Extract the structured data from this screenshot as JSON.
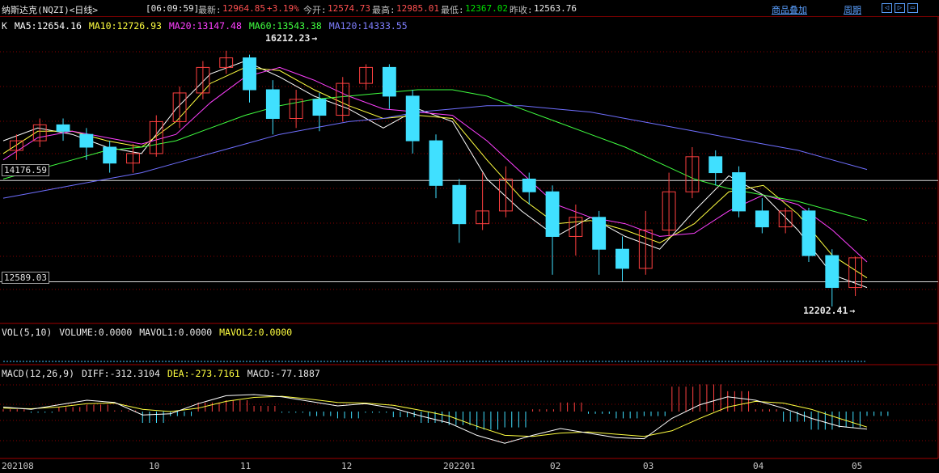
{
  "header": {
    "title": "纳斯达克(NQZI)<日线>",
    "time": "[06:09:59]",
    "latest_label": "最新:",
    "latest_value": "12964.85",
    "change_pct": "+3.19%",
    "open_label": "今开:",
    "open_value": "12574.73",
    "high_label": "最高:",
    "high_value": "12985.01",
    "low_label": "最低:",
    "low_value": "12367.02",
    "prev_label": "昨收:",
    "prev_value": "12563.76",
    "overlay_link": "商品叠加",
    "period_link": "周期",
    "controls": [
      "◁",
      "▷",
      "▭"
    ]
  },
  "k_legend": {
    "prefix": "K",
    "ma5": "MA5:12654.16",
    "ma10": "MA10:12726.93",
    "ma20": "MA20:13147.48",
    "ma60": "MA60:13543.38",
    "ma120": "MA120:14333.55"
  },
  "vol_legend": {
    "name": "VOL(5,10)",
    "volume": "VOLUME:0.0000",
    "mavol1": "MAVOL1:0.0000",
    "mavol2": "MAVOL2:0.0000"
  },
  "macd_legend": {
    "name": "MACD(12,26,9)",
    "diff": "DIFF:-312.3104",
    "dea": "DEA:-273.7161",
    "macd": "MACD:-77.1887"
  },
  "price_levels": {
    "upper": "14176.59",
    "lower": "12589.03"
  },
  "annotations": {
    "high": "16212.23",
    "low": "12202.41"
  },
  "colors": {
    "up": "#ff4040",
    "down": "#40e0ff",
    "ma5": "#ffffff",
    "ma10": "#ffff40",
    "ma20": "#ff40ff",
    "ma60": "#40ff40",
    "ma120": "#6f6fff",
    "grid": "#8a0000"
  },
  "chart_data": {
    "type": "candlestick",
    "x_tick_labels": [
      "202108",
      "10",
      "11",
      "12",
      "202201",
      "02",
      "03",
      "04",
      "05"
    ],
    "price_ylim": [
      12000,
      16500
    ],
    "ma_series": [
      {
        "name": "MA5",
        "values": [
          14800,
          15000,
          14900,
          14700,
          14600,
          15300,
          15850,
          16050,
          15800,
          15500,
          15300,
          15000,
          15300,
          15100,
          14200,
          13700,
          13300,
          13600,
          13300,
          13100,
          13700,
          14250,
          13950,
          13400,
          12700,
          12500
        ]
      },
      {
        "name": "MA10",
        "values": [
          14600,
          14950,
          14950,
          14800,
          14700,
          15100,
          15700,
          15950,
          15900,
          15600,
          15350,
          15150,
          15200,
          15150,
          14500,
          13900,
          13500,
          13550,
          13400,
          13200,
          13500,
          14000,
          14100,
          13650,
          13000,
          12650
        ]
      },
      {
        "name": "MA20",
        "values": [
          14500,
          14850,
          14950,
          14850,
          14750,
          14900,
          15400,
          15800,
          15950,
          15750,
          15500,
          15300,
          15250,
          15200,
          14800,
          14300,
          13800,
          13600,
          13500,
          13300,
          13350,
          13700,
          13950,
          13800,
          13400,
          12900
        ]
      },
      {
        "name": "MA60",
        "values": [
          14200,
          14350,
          14500,
          14650,
          14700,
          14800,
          15000,
          15200,
          15350,
          15450,
          15500,
          15550,
          15600,
          15600,
          15500,
          15300,
          15100,
          14900,
          14700,
          14450,
          14200,
          14050,
          13950,
          13850,
          13700,
          13550
        ]
      },
      {
        "name": "MA120",
        "values": [
          13900,
          14000,
          14100,
          14200,
          14300,
          14450,
          14600,
          14750,
          14900,
          15000,
          15100,
          15150,
          15250,
          15300,
          15350,
          15350,
          15300,
          15250,
          15150,
          15050,
          14950,
          14850,
          14750,
          14650,
          14500,
          14350
        ]
      }
    ],
    "candles": [
      {
        "o": 14650,
        "c": 14800,
        "h": 14900,
        "l": 14500
      },
      {
        "o": 14800,
        "c": 15050,
        "h": 15150,
        "l": 14700
      },
      {
        "o": 15050,
        "c": 14950,
        "h": 15150,
        "l": 14800
      },
      {
        "o": 14900,
        "c": 14700,
        "h": 15000,
        "l": 14500
      },
      {
        "o": 14700,
        "c": 14450,
        "h": 14800,
        "l": 14300
      },
      {
        "o": 14450,
        "c": 14600,
        "h": 14750,
        "l": 14300
      },
      {
        "o": 14600,
        "c": 15100,
        "h": 15200,
        "l": 14550
      },
      {
        "o": 15100,
        "c": 15550,
        "h": 15650,
        "l": 15000
      },
      {
        "o": 15550,
        "c": 15950,
        "h": 16050,
        "l": 15450
      },
      {
        "o": 15950,
        "c": 16100,
        "h": 16212,
        "l": 15850
      },
      {
        "o": 16100,
        "c": 15600,
        "h": 16150,
        "l": 15400
      },
      {
        "o": 15600,
        "c": 15150,
        "h": 15750,
        "l": 14900
      },
      {
        "o": 15150,
        "c": 15450,
        "h": 15600,
        "l": 15000
      },
      {
        "o": 15450,
        "c": 15200,
        "h": 15550,
        "l": 14950
      },
      {
        "o": 15200,
        "c": 15700,
        "h": 15800,
        "l": 15100
      },
      {
        "o": 15700,
        "c": 15950,
        "h": 16000,
        "l": 15600
      },
      {
        "o": 15950,
        "c": 15500,
        "h": 16000,
        "l": 15300
      },
      {
        "o": 15500,
        "c": 14800,
        "h": 15600,
        "l": 14600
      },
      {
        "o": 14800,
        "c": 14100,
        "h": 14900,
        "l": 13900
      },
      {
        "o": 14100,
        "c": 13500,
        "h": 14200,
        "l": 13200
      },
      {
        "o": 13500,
        "c": 13700,
        "h": 14300,
        "l": 13400
      },
      {
        "o": 13700,
        "c": 14200,
        "h": 14400,
        "l": 13600
      },
      {
        "o": 14200,
        "c": 14000,
        "h": 14300,
        "l": 13800
      },
      {
        "o": 14000,
        "c": 13300,
        "h": 14100,
        "l": 12700
      },
      {
        "o": 13300,
        "c": 13600,
        "h": 13800,
        "l": 13000
      },
      {
        "o": 13600,
        "c": 13100,
        "h": 13700,
        "l": 12700
      },
      {
        "o": 13100,
        "c": 12800,
        "h": 13300,
        "l": 12600
      },
      {
        "o": 12800,
        "c": 13400,
        "h": 13700,
        "l": 12700
      },
      {
        "o": 13400,
        "c": 14000,
        "h": 14300,
        "l": 13300
      },
      {
        "o": 14000,
        "c": 14550,
        "h": 14700,
        "l": 13900
      },
      {
        "o": 14550,
        "c": 14300,
        "h": 14650,
        "l": 14100
      },
      {
        "o": 14300,
        "c": 13700,
        "h": 14400,
        "l": 13600
      },
      {
        "o": 13700,
        "c": 13450,
        "h": 13900,
        "l": 13350
      },
      {
        "o": 13450,
        "c": 13700,
        "h": 13750,
        "l": 13350
      },
      {
        "o": 13700,
        "c": 13000,
        "h": 13750,
        "l": 12900
      },
      {
        "o": 13000,
        "c": 12500,
        "h": 13100,
        "l": 12202
      },
      {
        "o": 12500,
        "c": 12965,
        "h": 12985,
        "l": 12367
      }
    ],
    "macd": {
      "diff": [
        80,
        40,
        120,
        200,
        160,
        -60,
        -40,
        140,
        280,
        300,
        260,
        180,
        100,
        140,
        60,
        -80,
        -200,
        -420,
        -560,
        -420,
        -300,
        -380,
        -460,
        -480,
        -120,
        120,
        260,
        200,
        60,
        -120,
        -260,
        -312
      ],
      "dea": [
        60,
        50,
        80,
        140,
        150,
        40,
        0,
        60,
        180,
        250,
        270,
        220,
        160,
        150,
        110,
        20,
        -80,
        -260,
        -420,
        -440,
        -380,
        -360,
        -400,
        -440,
        -340,
        -120,
        80,
        180,
        150,
        40,
        -120,
        -274
      ],
      "hist": [
        40,
        -20,
        80,
        120,
        20,
        -200,
        -80,
        160,
        200,
        100,
        -20,
        -80,
        -120,
        -20,
        -100,
        -200,
        -240,
        -320,
        -280,
        40,
        160,
        -40,
        -120,
        -80,
        440,
        480,
        360,
        40,
        -180,
        -320,
        -280,
        -77
      ]
    }
  }
}
